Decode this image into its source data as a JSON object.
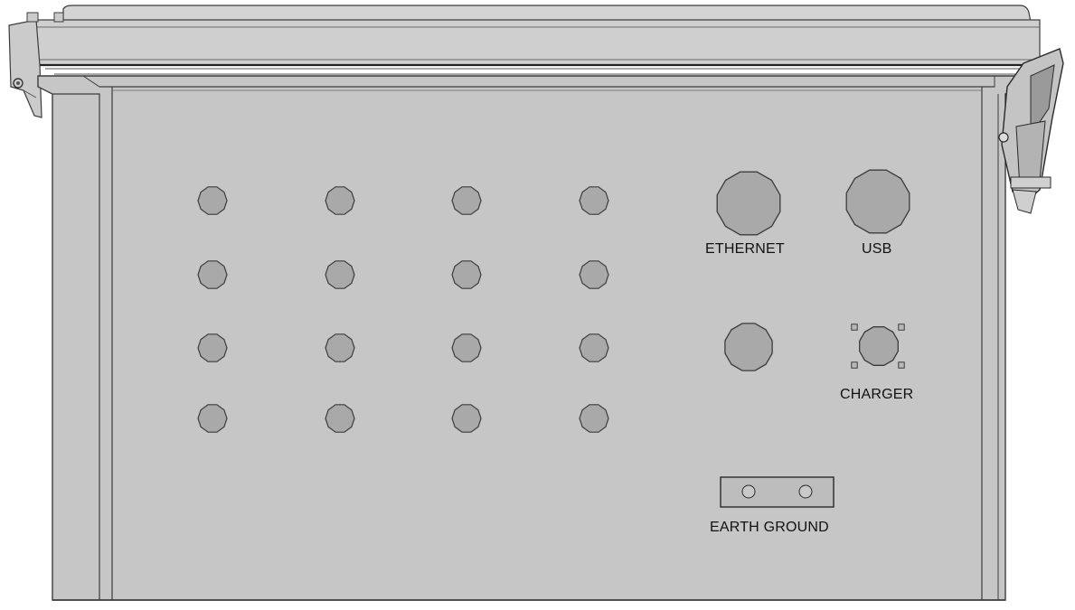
{
  "labels": {
    "ethernet": "ETHERNET",
    "usb": "USB",
    "charger": "CHARGER",
    "earth_ground": "EARTH GROUND"
  },
  "connector_grid": {
    "rows": 4,
    "columns": 4
  },
  "colors": {
    "enclosure_body": "#c6c6c6",
    "enclosure_lid": "#cfcfcf",
    "port_fill": "#a9a9a9",
    "outline": "#3c3c3c",
    "ground_bar": "#bdbdbd"
  }
}
